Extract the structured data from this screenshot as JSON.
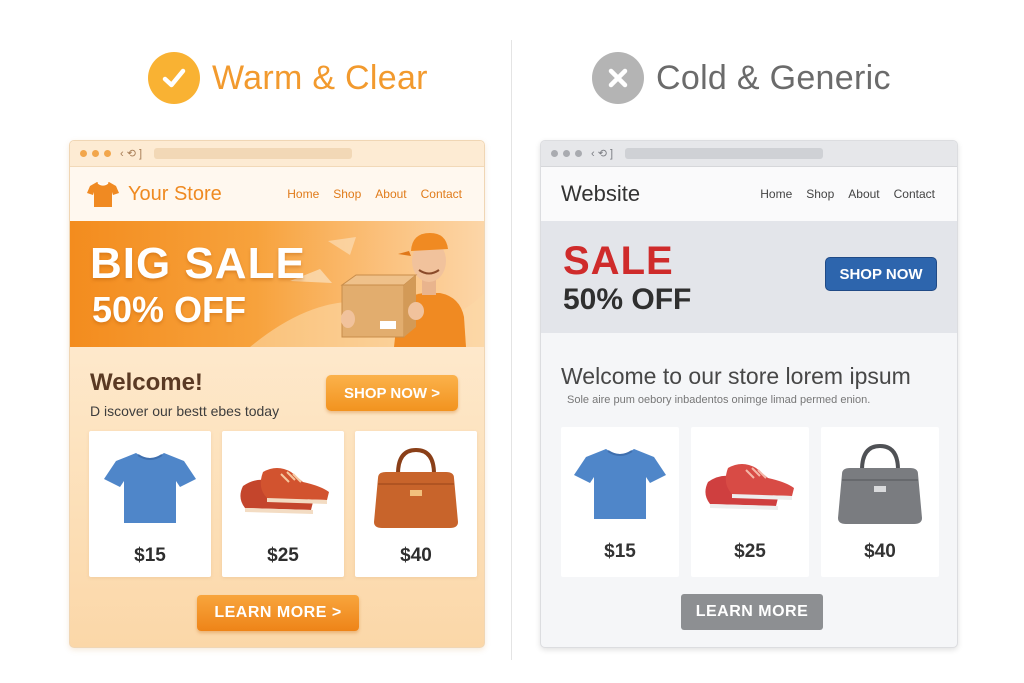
{
  "warm": {
    "heading": "Warm & Clear",
    "badge_icon": "checkmark-icon",
    "chrome_glyph": "‹ ⟲ ]",
    "store_name": "Your Store",
    "nav": [
      "Home",
      "Shop",
      "About",
      "Contact"
    ],
    "hero_line1": "BIG SALE",
    "hero_line2": "50% OFF",
    "welcome_title": "Welcome!",
    "welcome_sub": "D iscover our bestt ebes today",
    "shop_now": "SHOP NOW >",
    "products": [
      {
        "icon": "tshirt-icon",
        "price": "$15"
      },
      {
        "icon": "sneakers-icon",
        "price": "$25"
      },
      {
        "icon": "handbag-icon",
        "price": "$40"
      }
    ],
    "learn_more": "LEARN MORE >",
    "accent": "#f29a2e"
  },
  "cold": {
    "heading": "Cold & Generic",
    "badge_icon": "x-icon",
    "chrome_glyph": "‹ ⟲ ]",
    "site_name": "Website",
    "nav": [
      "Home",
      "Shop",
      "About",
      "Contact"
    ],
    "hero_line1": "SALE",
    "hero_line2": "50% OFF",
    "shop_now": "SHOP NOW",
    "welcome_title": "Welcome to our store lorem ipsum",
    "welcome_sub": "Sole aire pum oebory inbadentos onimge limad permed enion.",
    "products": [
      {
        "icon": "tshirt-icon",
        "price": "$15"
      },
      {
        "icon": "sneakers-icon",
        "price": "$25"
      },
      {
        "icon": "handbag-icon",
        "price": "$40"
      }
    ],
    "learn_more": "LEARN MORE",
    "accent": "#cf2b2b",
    "button_blue": "#2d65ad"
  }
}
